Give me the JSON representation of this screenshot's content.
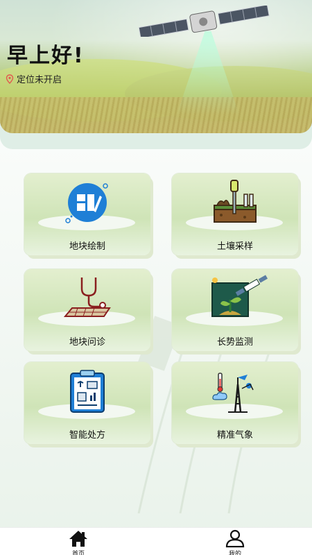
{
  "header": {
    "greeting": "早上好!",
    "location_status": "定位未开启"
  },
  "features": [
    {
      "label": "地块绘制",
      "icon": "plot-drawing-icon"
    },
    {
      "label": "土壤采样",
      "icon": "soil-sampling-icon"
    },
    {
      "label": "地块问诊",
      "icon": "plot-diagnosis-icon"
    },
    {
      "label": "长势监测",
      "icon": "growth-monitoring-icon"
    },
    {
      "label": "智能处方",
      "icon": "smart-prescription-icon"
    },
    {
      "label": "精准气象",
      "icon": "precision-weather-icon"
    }
  ],
  "tabbar": {
    "items": [
      {
        "label": "首页",
        "icon": "home-icon"
      },
      {
        "label": "我的",
        "icon": "user-icon"
      }
    ]
  },
  "colors": {
    "card_green": "#cfe4b7",
    "icon_blue": "#1f7fd6",
    "location_pin": "#e25a4f"
  }
}
